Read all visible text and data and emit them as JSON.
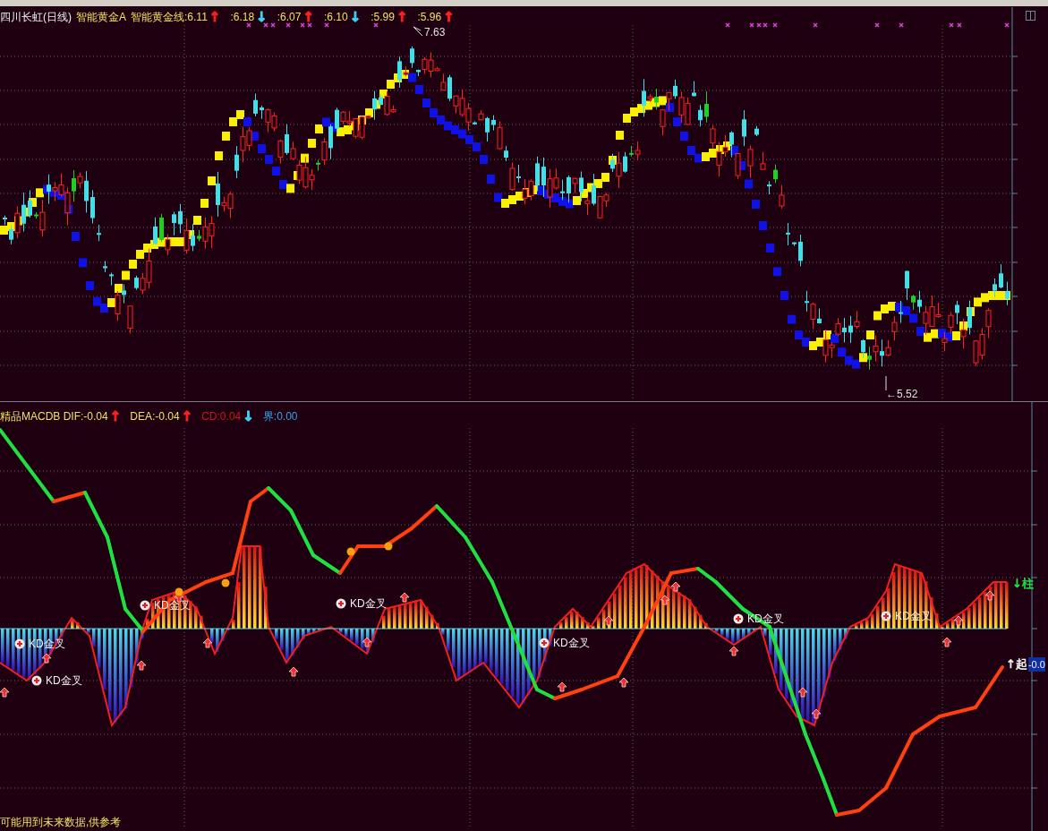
{
  "price_panel": {
    "stock": "四川长虹(日线)",
    "indicator": "智能黄金A",
    "legend": [
      {
        "label": "智能黄金线:6.11",
        "arrow": {
          "text": "↑",
          "color": "#ff2020"
        }
      },
      {
        "label": ":6.18",
        "arrow": {
          "text": "↓",
          "color": "#40d0f0"
        }
      },
      {
        "label": ":6.07",
        "arrow": {
          "text": "↑",
          "color": "#ff2020"
        }
      },
      {
        "label": ":6.10",
        "arrow": {
          "text": "↓",
          "color": "#40d0f0"
        }
      },
      {
        "label": ":5.99",
        "arrow": {
          "text": "↑",
          "color": "#ff2020"
        }
      },
      {
        "label": ":5.96",
        "arrow": {
          "text": "↑",
          "color": "#ff2020"
        }
      }
    ],
    "high_label": "7.63",
    "low_label": "←5.52"
  },
  "macd_panel": {
    "legend": [
      {
        "label": "精品MACDB DIF:-0.04",
        "arrow": {
          "text": "↑",
          "color": "#ff2020"
        },
        "color": "#f0e060"
      },
      {
        "label": "DEA:-0.04",
        "arrow": {
          "text": "↑",
          "color": "#ff2020"
        },
        "color": "#f0e060"
      },
      {
        "label": "CD:0.04",
        "arrow": {
          "text": "↓",
          "color": "#40d0f0"
        },
        "color": "#c81818"
      },
      {
        "label": "界:0.00",
        "color": "#3aa0e8"
      }
    ],
    "signals": [
      {
        "label": "KD金叉"
      },
      {
        "label": "KD金叉"
      },
      {
        "label": "KD金叉"
      },
      {
        "label": "KD金叉"
      },
      {
        "label": "KD金叉"
      },
      {
        "label": "KD金叉"
      },
      {
        "label": "KD金叉"
      }
    ],
    "axis_labels": [
      {
        "label": "↓柱",
        "color": "#20e040"
      },
      {
        "label": "↑起",
        "color": "#f0f0f0",
        "value": "-0.0"
      }
    ],
    "footnote": "可能用到未来数据,供参考"
  }
}
